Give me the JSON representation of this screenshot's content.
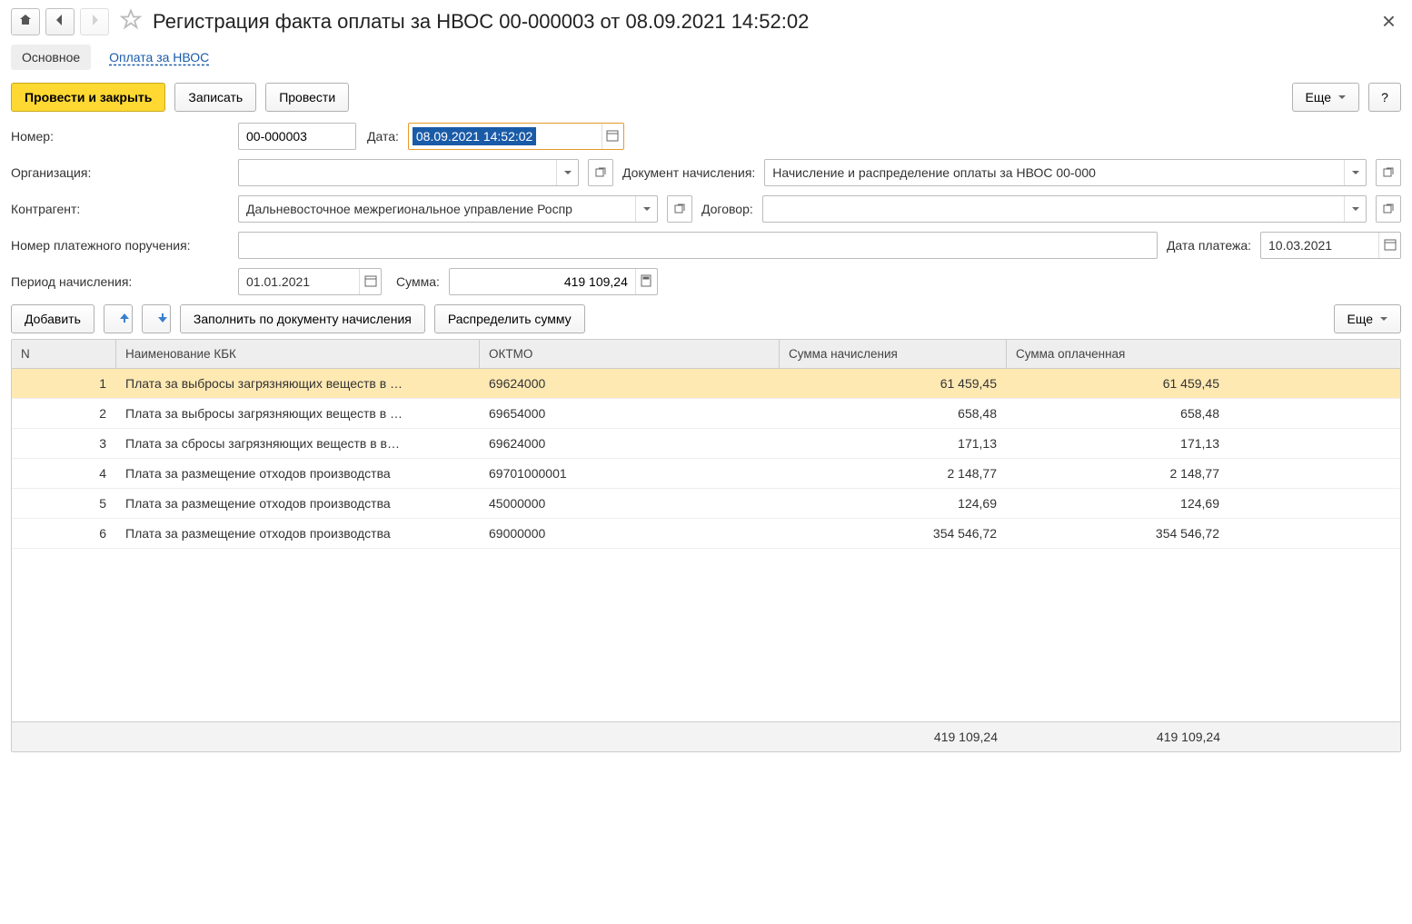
{
  "header": {
    "title": "Регистрация факта оплаты за НВОС 00-000003 от 08.09.2021 14:52:02"
  },
  "tabs": {
    "main": "Основное",
    "link": "Оплата за НВОС"
  },
  "toolbar": {
    "post_close": "Провести и закрыть",
    "save": "Записать",
    "post": "Провести",
    "more": "Еще",
    "help": "?"
  },
  "form": {
    "number_label": "Номер:",
    "number_value": "00-000003",
    "date_label": "Дата:",
    "date_value": "08.09.2021 14:52:02",
    "org_label": "Организация:",
    "org_value": " ",
    "accrual_doc_label": "Документ начисления:",
    "accrual_doc_value": "Начисление и распределение оплаты за НВОС 00-000",
    "counterparty_label": "Контрагент:",
    "counterparty_value": "Дальневосточное межрегиональное управление Роспр",
    "contract_label": "Договор:",
    "contract_value": "",
    "payorder_label": "Номер платежного поручения:",
    "payorder_value": "",
    "paydate_label": "Дата платежа:",
    "paydate_value": "10.03.2021",
    "period_label": "Период начисления:",
    "period_value": "01.01.2021",
    "sum_label": "Сумма:",
    "sum_value": "419 109,24"
  },
  "table_toolbar": {
    "add": "Добавить",
    "fill": "Заполнить по документу начисления",
    "distribute": "Распределить сумму",
    "more": "Еще"
  },
  "table": {
    "headers": {
      "n": "N",
      "name": "Наименование КБК",
      "oktmo": "ОКТМО",
      "sum_acc": "Сумма начисления",
      "sum_paid": "Сумма оплаченная"
    },
    "rows": [
      {
        "n": "1",
        "name": "Плата за выбросы загрязняющих веществ в …",
        "oktmo": "69624000",
        "sum_acc": "61 459,45",
        "sum_paid": "61 459,45",
        "sel": true
      },
      {
        "n": "2",
        "name": "Плата за выбросы загрязняющих веществ в …",
        "oktmo": "69654000",
        "sum_acc": "658,48",
        "sum_paid": "658,48"
      },
      {
        "n": "3",
        "name": "Плата за сбросы загрязняющих веществ в в…",
        "oktmo": "69624000",
        "sum_acc": "171,13",
        "sum_paid": "171,13"
      },
      {
        "n": "4",
        "name": "Плата за размещение отходов производства",
        "oktmo": "69701000001",
        "sum_acc": "2 148,77",
        "sum_paid": "2 148,77"
      },
      {
        "n": "5",
        "name": "Плата за размещение отходов производства",
        "oktmo": "45000000",
        "sum_acc": "124,69",
        "sum_paid": "124,69"
      },
      {
        "n": "6",
        "name": "Плата за размещение отходов производства",
        "oktmo": "69000000",
        "sum_acc": "354 546,72",
        "sum_paid": "354 546,72"
      }
    ],
    "footer": {
      "sum_acc": "419 109,24",
      "sum_paid": "419 109,24"
    }
  }
}
